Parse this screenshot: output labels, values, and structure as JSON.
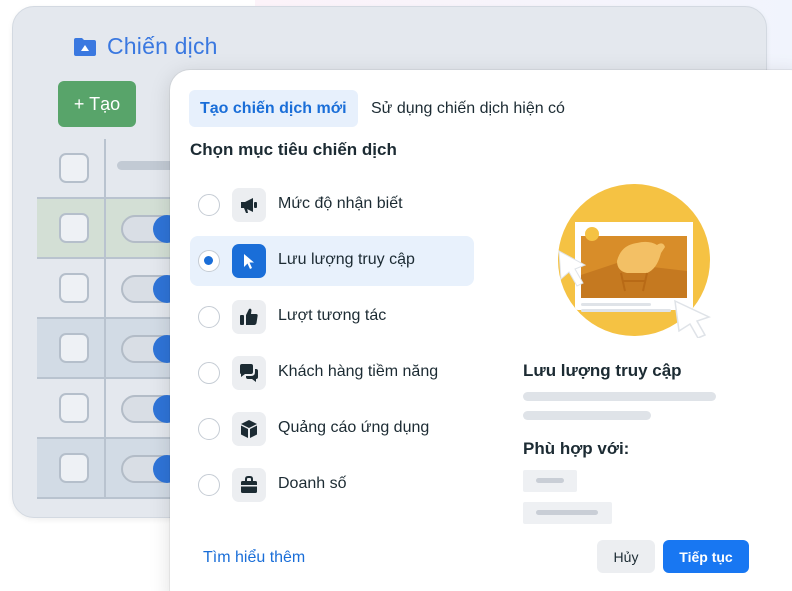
{
  "back_panel": {
    "title": "Chiến dịch",
    "create_button": "+ Tạo",
    "rows": 6
  },
  "tabs": [
    {
      "label": "Tạo chiến dịch mới",
      "active": true
    },
    {
      "label": "Sử dụng chiến dịch hiện có",
      "active": false
    }
  ],
  "section_title": "Chọn mục tiêu chiến dịch",
  "objectives": [
    {
      "label": "Mức độ nhận biết",
      "icon": "megaphone-icon",
      "selected": false
    },
    {
      "label": "Lưu lượng truy cập",
      "icon": "cursor-icon",
      "selected": true
    },
    {
      "label": "Lượt tương tác",
      "icon": "thumbs-up-icon",
      "selected": false
    },
    {
      "label": "Khách hàng tiềm năng",
      "icon": "chat-bubbles-icon",
      "selected": false
    },
    {
      "label": "Quảng cáo ứng dụng",
      "icon": "cube-icon",
      "selected": false
    },
    {
      "label": "Doanh số",
      "icon": "shopping-bag-icon",
      "selected": false
    }
  ],
  "detail": {
    "title": "Lưu lượng truy cập",
    "suitable_title": "Phù hợp với:"
  },
  "footer": {
    "learn_more": "Tìm hiểu thêm",
    "cancel": "Hủy",
    "continue": "Tiếp tục"
  },
  "colors": {
    "accent": "#1877f2",
    "create_button": "#58a46a",
    "illustration": "#f5c243"
  }
}
